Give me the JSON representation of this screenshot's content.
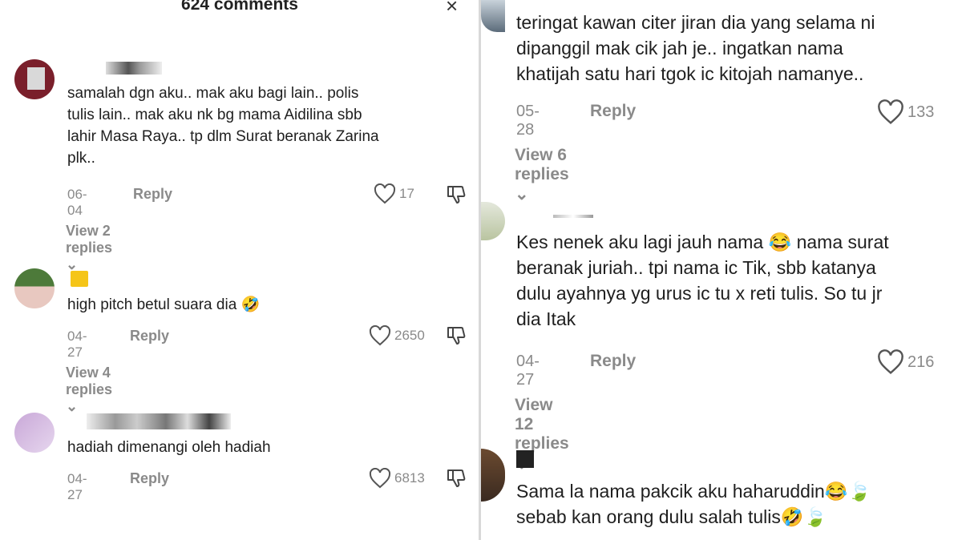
{
  "header": {
    "title": "624 comments",
    "close_glyph": "×",
    "close_icon": "close-icon"
  },
  "left_comments": [
    {
      "text": "samalah dgn aku.. mak aku bagi lain.. polis\ntulis lain.. mak aku nk bg mama Aidilina sbb\nlahir Masa Raya.. tp dlm Surat beranak Zarina\nplk..",
      "date": "06-04",
      "reply": "Reply",
      "likes": "17",
      "view_replies": "View 2 replies ⌄",
      "avatar_colors": [
        "#7a1f2b",
        "#c9c9c9"
      ]
    },
    {
      "text": "high pitch betul suara dia 🤣",
      "date": "04-27",
      "reply": "Reply",
      "likes": "2650",
      "view_replies": "View 4 replies ⌄",
      "badge_color": "#f5c518",
      "avatar_colors": [
        "#4d7a3a",
        "#e8c8c0"
      ]
    },
    {
      "text": "hadiah dimenangi oleh hadiah",
      "date": "04-27",
      "reply": "Reply",
      "likes": "6813",
      "avatar_colors": [
        "#c9a8d8",
        "#e6d6ee"
      ]
    }
  ],
  "right_comments": [
    {
      "text": "teringat kawan citer jiran dia yang selama ni\ndipanggil mak cik jah je.. ingatkan nama\nkhatijah satu hari tgok ic kitojah namanye..",
      "date": "05-28",
      "reply": "Reply",
      "likes": "133",
      "view_replies": "View 6 replies ⌄",
      "avatar_colors": [
        "#5b6b7a",
        "#c8d2da"
      ]
    },
    {
      "text": "Kes nenek aku lagi jauh nama 😂 nama surat\nberanak juriah.. tpi nama ic Tik, sbb katanya\ndulu ayahnya yg urus ic tu x reti tulis. So tu jr\ndia Itak",
      "date": "04-27",
      "reply": "Reply",
      "likes": "216",
      "view_replies": "View 12 replies ⌄",
      "avatar_colors": [
        "#b9c4a0",
        "#e4e8dc"
      ]
    },
    {
      "text": "Sama la nama pakcik aku haharuddin😂🍃\nsebab kan orang dulu salah tulis🤣🍃",
      "avatar_colors": [
        "#6b4a30",
        "#3a2a20"
      ]
    }
  ],
  "icons": {
    "like": "heart-icon",
    "dislike": "thumbs-down-icon",
    "chevron": "chevron-down-icon"
  },
  "colors": {
    "muted": "#8a8a8a",
    "text": "#1f1f1f"
  }
}
